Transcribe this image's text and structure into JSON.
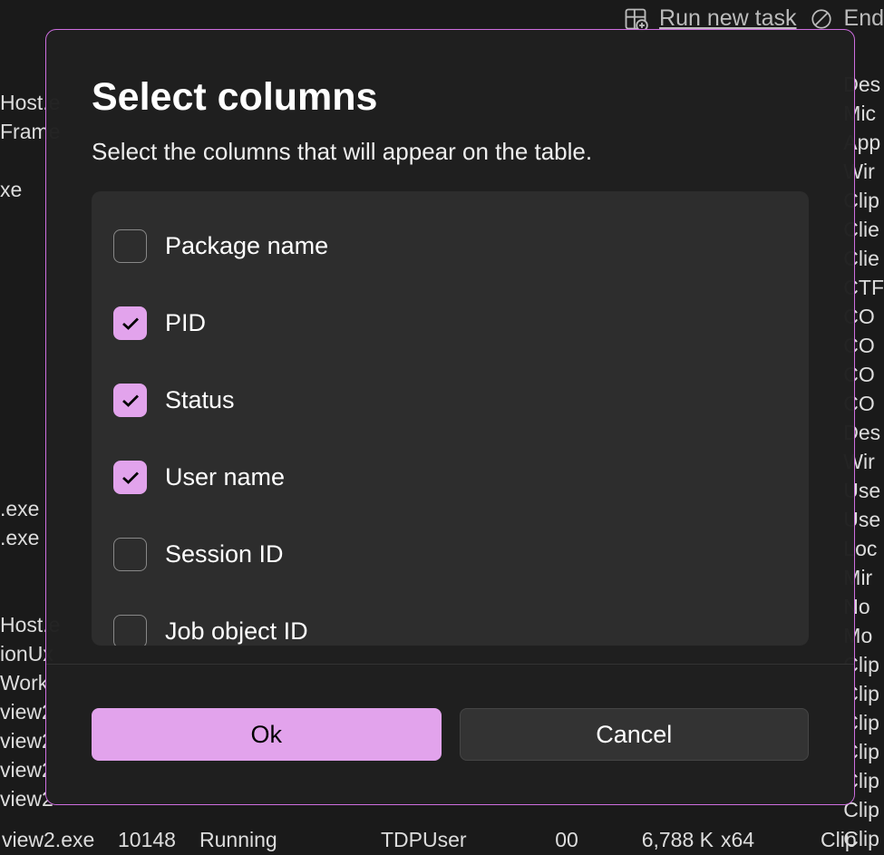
{
  "toolbar": {
    "run_new_task": "Run new task",
    "end_task": "End"
  },
  "dialog": {
    "title": "Select columns",
    "subtitle": "Select the columns that will appear on the table.",
    "options": [
      {
        "label": "Package name",
        "checked": false
      },
      {
        "label": "PID",
        "checked": true
      },
      {
        "label": "Status",
        "checked": true
      },
      {
        "label": "User name",
        "checked": true
      },
      {
        "label": "Session ID",
        "checked": false
      },
      {
        "label": "Job object ID",
        "checked": false
      }
    ],
    "ok_label": "Ok",
    "cancel_label": "Cancel"
  },
  "background": {
    "right_truncated": [
      "Des",
      "Mic",
      "App",
      "Wir",
      "Clip",
      "Clie",
      "Clie",
      "CTF",
      "CO",
      "CO",
      "CO",
      "CO",
      "Des",
      "Wir",
      "Use",
      "Use",
      "Loc",
      "Mir",
      "No",
      "Mo",
      "Clip",
      "Clip",
      "Clip",
      "Clip",
      "Clip",
      "Clip",
      "Clip"
    ],
    "left_truncated": [
      "Host.e",
      "Frame",
      "",
      "xe",
      "",
      "",
      "",
      "",
      "",
      "",
      "",
      "",
      "",
      "",
      ".exe",
      ".exe",
      "",
      "",
      "Host.e",
      "ionUx",
      "Work",
      "view2",
      "view2",
      "view2",
      "view2"
    ],
    "bottom_rows": [
      {
        "name": "view2.exe",
        "pid": "10148",
        "status": "Running",
        "user": "TDPUser",
        "session": "00",
        "mem": "6,788 K",
        "arch": "x64",
        "desc": "Clip"
      }
    ]
  }
}
